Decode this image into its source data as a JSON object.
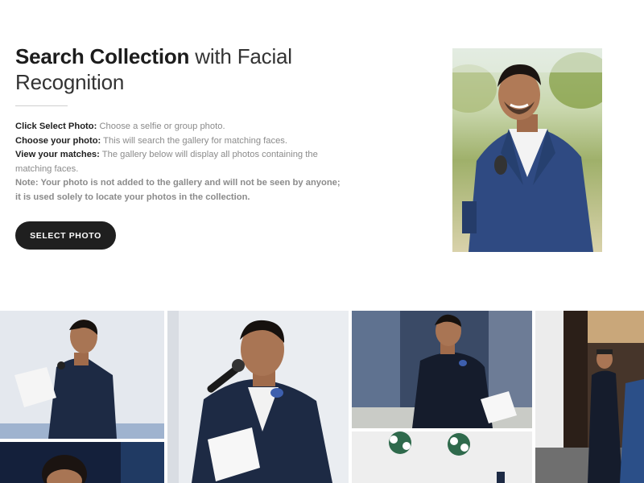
{
  "hero": {
    "title_bold": "Search Collection",
    "title_light": " with Facial Recognition",
    "steps": [
      {
        "label": "Click Select Photo:",
        "text": " Choose a selfie or group photo."
      },
      {
        "label": "Choose your photo:",
        "text": " This will search the gallery for matching faces."
      },
      {
        "label": "View your matches:",
        "text": " The gallery below will display all photos containing the matching faces."
      }
    ],
    "note": "Note: Your photo is not added to the gallery and will not be seen by anyone; it is used solely to locate your photos in the collection.",
    "button_label": "SELECT PHOTO"
  },
  "colors": {
    "button_bg": "#1f1f1f",
    "suit": "#1d2a44",
    "blazer": "#2f4a82"
  }
}
